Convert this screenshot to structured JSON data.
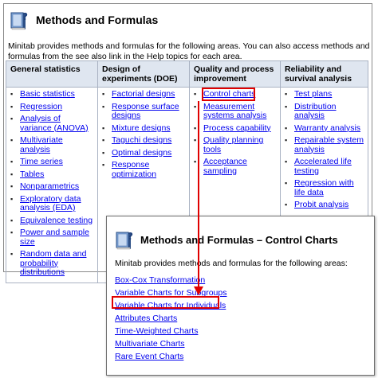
{
  "back_panel": {
    "title": "Methods and Formulas",
    "intro": "Minitab provides methods and formulas for the following areas. You can also access methods and formulas from the see also link in the Help topics for each area.",
    "columns": [
      {
        "header": "General statistics",
        "items": [
          "Basic statistics",
          "Regression",
          "Analysis of variance (ANOVA)",
          "Multivariate analysis",
          "Time series",
          "Tables",
          "Nonparametrics",
          "Exploratory data analysis (EDA)",
          "Equivalence testing",
          "Power and sample size",
          "Random data and probability distributions"
        ]
      },
      {
        "header": "Design of experiments (DOE)",
        "items": [
          "Factorial designs",
          "Response surface designs",
          "Mixture designs",
          "Taguchi designs",
          "Optimal designs",
          "Response optimization"
        ]
      },
      {
        "header": "Quality and process improvement",
        "items": [
          "Control charts",
          "Measurement systems analysis",
          "Process capability",
          "Quality planning tools",
          "Acceptance sampling"
        ]
      },
      {
        "header": "Reliability and survival analysis",
        "items": [
          "Test plans",
          "Distribution analysis",
          "Warranty analysis",
          "Repairable system analysis",
          "Accelerated life testing",
          "Regression with life data",
          "Probit analysis"
        ]
      }
    ]
  },
  "front_panel": {
    "title": "Methods and Formulas – Control Charts",
    "intro": "Minitab provides methods and formulas for the following areas:",
    "items": [
      "Box-Cox Transformation",
      "Variable Charts for Subgroups",
      "Variable Charts for Individuals",
      "Attributes Charts",
      "Time-Weighted Charts",
      "Multivariate Charts",
      "Rare Event Charts"
    ]
  },
  "colors": {
    "link": "#0000ee",
    "highlight": "#e00000",
    "header_bg": "#dfe6f0"
  },
  "icons": {
    "header_icon": "help-book-icon"
  }
}
